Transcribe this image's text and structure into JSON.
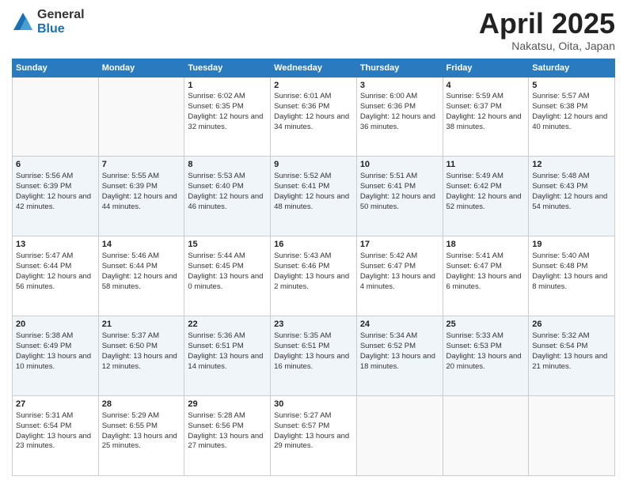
{
  "logo": {
    "general": "General",
    "blue": "Blue"
  },
  "title": {
    "month": "April 2025",
    "location": "Nakatsu, Oita, Japan"
  },
  "weekdays": [
    "Sunday",
    "Monday",
    "Tuesday",
    "Wednesday",
    "Thursday",
    "Friday",
    "Saturday"
  ],
  "weeks": [
    [
      {
        "day": "",
        "sunrise": "",
        "sunset": "",
        "daylight": ""
      },
      {
        "day": "",
        "sunrise": "",
        "sunset": "",
        "daylight": ""
      },
      {
        "day": "1",
        "sunrise": "Sunrise: 6:02 AM",
        "sunset": "Sunset: 6:35 PM",
        "daylight": "Daylight: 12 hours and 32 minutes."
      },
      {
        "day": "2",
        "sunrise": "Sunrise: 6:01 AM",
        "sunset": "Sunset: 6:36 PM",
        "daylight": "Daylight: 12 hours and 34 minutes."
      },
      {
        "day": "3",
        "sunrise": "Sunrise: 6:00 AM",
        "sunset": "Sunset: 6:36 PM",
        "daylight": "Daylight: 12 hours and 36 minutes."
      },
      {
        "day": "4",
        "sunrise": "Sunrise: 5:59 AM",
        "sunset": "Sunset: 6:37 PM",
        "daylight": "Daylight: 12 hours and 38 minutes."
      },
      {
        "day": "5",
        "sunrise": "Sunrise: 5:57 AM",
        "sunset": "Sunset: 6:38 PM",
        "daylight": "Daylight: 12 hours and 40 minutes."
      }
    ],
    [
      {
        "day": "6",
        "sunrise": "Sunrise: 5:56 AM",
        "sunset": "Sunset: 6:39 PM",
        "daylight": "Daylight: 12 hours and 42 minutes."
      },
      {
        "day": "7",
        "sunrise": "Sunrise: 5:55 AM",
        "sunset": "Sunset: 6:39 PM",
        "daylight": "Daylight: 12 hours and 44 minutes."
      },
      {
        "day": "8",
        "sunrise": "Sunrise: 5:53 AM",
        "sunset": "Sunset: 6:40 PM",
        "daylight": "Daylight: 12 hours and 46 minutes."
      },
      {
        "day": "9",
        "sunrise": "Sunrise: 5:52 AM",
        "sunset": "Sunset: 6:41 PM",
        "daylight": "Daylight: 12 hours and 48 minutes."
      },
      {
        "day": "10",
        "sunrise": "Sunrise: 5:51 AM",
        "sunset": "Sunset: 6:41 PM",
        "daylight": "Daylight: 12 hours and 50 minutes."
      },
      {
        "day": "11",
        "sunrise": "Sunrise: 5:49 AM",
        "sunset": "Sunset: 6:42 PM",
        "daylight": "Daylight: 12 hours and 52 minutes."
      },
      {
        "day": "12",
        "sunrise": "Sunrise: 5:48 AM",
        "sunset": "Sunset: 6:43 PM",
        "daylight": "Daylight: 12 hours and 54 minutes."
      }
    ],
    [
      {
        "day": "13",
        "sunrise": "Sunrise: 5:47 AM",
        "sunset": "Sunset: 6:44 PM",
        "daylight": "Daylight: 12 hours and 56 minutes."
      },
      {
        "day": "14",
        "sunrise": "Sunrise: 5:46 AM",
        "sunset": "Sunset: 6:44 PM",
        "daylight": "Daylight: 12 hours and 58 minutes."
      },
      {
        "day": "15",
        "sunrise": "Sunrise: 5:44 AM",
        "sunset": "Sunset: 6:45 PM",
        "daylight": "Daylight: 13 hours and 0 minutes."
      },
      {
        "day": "16",
        "sunrise": "Sunrise: 5:43 AM",
        "sunset": "Sunset: 6:46 PM",
        "daylight": "Daylight: 13 hours and 2 minutes."
      },
      {
        "day": "17",
        "sunrise": "Sunrise: 5:42 AM",
        "sunset": "Sunset: 6:47 PM",
        "daylight": "Daylight: 13 hours and 4 minutes."
      },
      {
        "day": "18",
        "sunrise": "Sunrise: 5:41 AM",
        "sunset": "Sunset: 6:47 PM",
        "daylight": "Daylight: 13 hours and 6 minutes."
      },
      {
        "day": "19",
        "sunrise": "Sunrise: 5:40 AM",
        "sunset": "Sunset: 6:48 PM",
        "daylight": "Daylight: 13 hours and 8 minutes."
      }
    ],
    [
      {
        "day": "20",
        "sunrise": "Sunrise: 5:38 AM",
        "sunset": "Sunset: 6:49 PM",
        "daylight": "Daylight: 13 hours and 10 minutes."
      },
      {
        "day": "21",
        "sunrise": "Sunrise: 5:37 AM",
        "sunset": "Sunset: 6:50 PM",
        "daylight": "Daylight: 13 hours and 12 minutes."
      },
      {
        "day": "22",
        "sunrise": "Sunrise: 5:36 AM",
        "sunset": "Sunset: 6:51 PM",
        "daylight": "Daylight: 13 hours and 14 minutes."
      },
      {
        "day": "23",
        "sunrise": "Sunrise: 5:35 AM",
        "sunset": "Sunset: 6:51 PM",
        "daylight": "Daylight: 13 hours and 16 minutes."
      },
      {
        "day": "24",
        "sunrise": "Sunrise: 5:34 AM",
        "sunset": "Sunset: 6:52 PM",
        "daylight": "Daylight: 13 hours and 18 minutes."
      },
      {
        "day": "25",
        "sunrise": "Sunrise: 5:33 AM",
        "sunset": "Sunset: 6:53 PM",
        "daylight": "Daylight: 13 hours and 20 minutes."
      },
      {
        "day": "26",
        "sunrise": "Sunrise: 5:32 AM",
        "sunset": "Sunset: 6:54 PM",
        "daylight": "Daylight: 13 hours and 21 minutes."
      }
    ],
    [
      {
        "day": "27",
        "sunrise": "Sunrise: 5:31 AM",
        "sunset": "Sunset: 6:54 PM",
        "daylight": "Daylight: 13 hours and 23 minutes."
      },
      {
        "day": "28",
        "sunrise": "Sunrise: 5:29 AM",
        "sunset": "Sunset: 6:55 PM",
        "daylight": "Daylight: 13 hours and 25 minutes."
      },
      {
        "day": "29",
        "sunrise": "Sunrise: 5:28 AM",
        "sunset": "Sunset: 6:56 PM",
        "daylight": "Daylight: 13 hours and 27 minutes."
      },
      {
        "day": "30",
        "sunrise": "Sunrise: 5:27 AM",
        "sunset": "Sunset: 6:57 PM",
        "daylight": "Daylight: 13 hours and 29 minutes."
      },
      {
        "day": "",
        "sunrise": "",
        "sunset": "",
        "daylight": ""
      },
      {
        "day": "",
        "sunrise": "",
        "sunset": "",
        "daylight": ""
      },
      {
        "day": "",
        "sunrise": "",
        "sunset": "",
        "daylight": ""
      }
    ]
  ]
}
